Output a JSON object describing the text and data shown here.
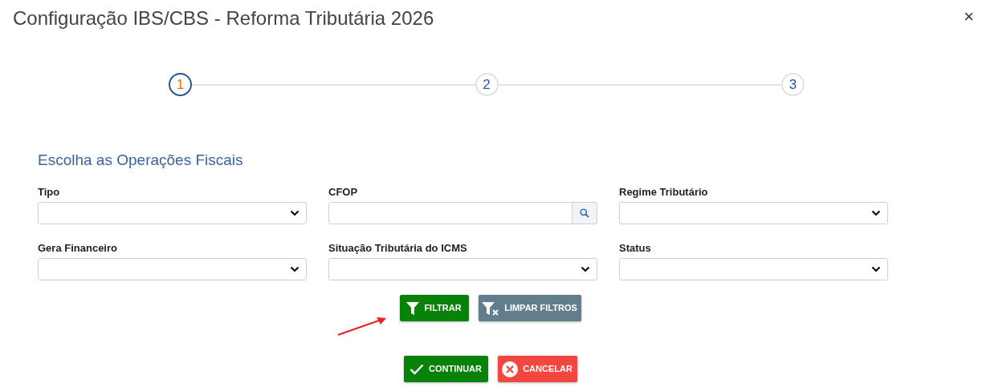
{
  "dialog": {
    "title": "Configuração IBS/CBS - Reforma Tributária 2026",
    "close": "×"
  },
  "steps": [
    {
      "label": "1",
      "selected": true
    },
    {
      "label": "2",
      "selected": false
    },
    {
      "label": "3",
      "selected": false
    }
  ],
  "section_title": "Escolha as Operações Fiscais",
  "fields": [
    {
      "label": "Tipo",
      "kind": "select"
    },
    {
      "label": "CFOP",
      "kind": "search"
    },
    {
      "label": "Regime Tributário",
      "kind": "select"
    },
    {
      "label": "Gera Financeiro",
      "kind": "select"
    },
    {
      "label": "Situação Tributária do ICMS",
      "kind": "select"
    },
    {
      "label": "Status",
      "kind": "select"
    }
  ],
  "filter_buttons": [
    {
      "label": "FILTRAR",
      "kind": "filter"
    },
    {
      "label": "LIMPAR FILTROS",
      "kind": "clear"
    }
  ],
  "action_buttons": [
    {
      "label": "CONTINUAR",
      "kind": "confirm"
    },
    {
      "label": "CANCELAR",
      "kind": "cancel"
    }
  ]
}
